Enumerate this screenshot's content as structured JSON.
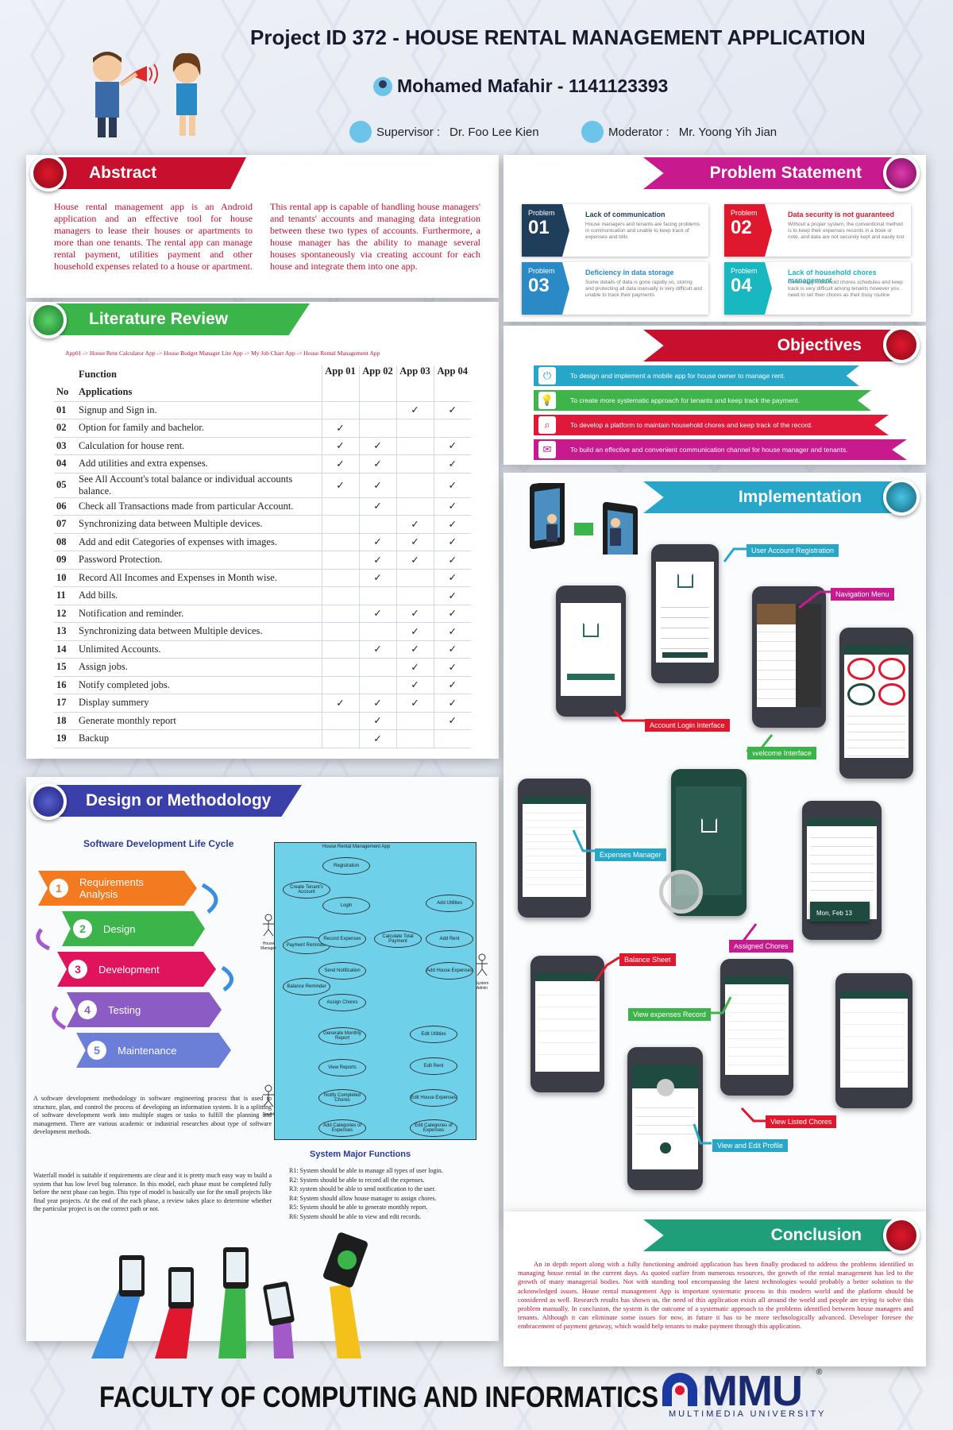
{
  "header": {
    "title": "Project ID 372 - HOUSE RENTAL MANAGEMENT APPLICATION",
    "student": "Mohamed Mafahir  -  1141123393",
    "supervisor_label": "Supervisor :",
    "supervisor": "Dr. Foo Lee Kien",
    "moderator_label": "Moderator :",
    "moderator": "Mr. Yoong Yih Jian"
  },
  "abstract": {
    "title": "Abstract",
    "p1": "House rental management app is an Android application and an effective tool for house managers to lease their houses or apartments to more than one tenants. The rental app can manage rental payment, utilities payment and other household expenses related to a house or apartment.",
    "p2": "This rental app is capable of handling house managers' and tenants' accounts and managing data integration between these two types of accounts. Furthermore, a house manager has the ability to manage several houses spontaneously via creating account for each house and integrate them into one app."
  },
  "literature": {
    "title": "Literature Review",
    "apps_note": "App01 -> House Rent Calculator App  ->  House Budget Manager Lite App  ->  My Job Chart App  ->  House Rental Management App",
    "head_function": "Function",
    "head_no": "No",
    "head_apps": "Applications",
    "app_cols": [
      "App 01",
      "App 02",
      "App 03",
      "App 04"
    ],
    "check": "✓",
    "rows": [
      {
        "no": "01",
        "f": "Signup and Sign in.",
        "m": [
          0,
          0,
          1,
          1
        ]
      },
      {
        "no": "02",
        "f": "Option for family and bachelor.",
        "m": [
          1,
          0,
          0,
          0
        ]
      },
      {
        "no": "03",
        "f": "Calculation for house rent.",
        "m": [
          1,
          1,
          0,
          1
        ]
      },
      {
        "no": "04",
        "f": "Add utilities and extra expenses.",
        "m": [
          1,
          1,
          0,
          1
        ]
      },
      {
        "no": "05",
        "f": "See All Account's total balance or individual accounts balance.",
        "m": [
          1,
          1,
          0,
          1
        ]
      },
      {
        "no": "06",
        "f": "Check all Transactions made from particular Account.",
        "m": [
          0,
          1,
          0,
          1
        ]
      },
      {
        "no": "07",
        "f": "Synchronizing data between Multiple devices.",
        "m": [
          0,
          0,
          1,
          1
        ]
      },
      {
        "no": "08",
        "f": "Add and edit Categories of expenses with images.",
        "m": [
          0,
          1,
          1,
          1
        ]
      },
      {
        "no": "09",
        "f": "Password Protection.",
        "m": [
          0,
          1,
          1,
          1
        ]
      },
      {
        "no": "10",
        "f": "Record All Incomes and Expenses in Month wise.",
        "m": [
          0,
          1,
          0,
          1
        ]
      },
      {
        "no": "11",
        "f": "Add bills.",
        "m": [
          0,
          0,
          0,
          1
        ]
      },
      {
        "no": "12",
        "f": "Notification and reminder.",
        "m": [
          0,
          1,
          1,
          1
        ]
      },
      {
        "no": "13",
        "f": "Synchronizing data between Multiple devices.",
        "m": [
          0,
          0,
          1,
          1
        ]
      },
      {
        "no": "14",
        "f": "Unlimited Accounts.",
        "m": [
          0,
          1,
          1,
          1
        ]
      },
      {
        "no": "15",
        "f": "Assign jobs.",
        "m": [
          0,
          0,
          1,
          1
        ]
      },
      {
        "no": "16",
        "f": "Notify completed jobs.",
        "m": [
          0,
          0,
          1,
          1
        ]
      },
      {
        "no": "17",
        "f": "Display summery",
        "m": [
          1,
          1,
          1,
          1
        ]
      },
      {
        "no": "18",
        "f": "Generate monthly report",
        "m": [
          0,
          1,
          0,
          1
        ]
      },
      {
        "no": "19",
        "f": "Backup",
        "m": [
          0,
          1,
          0,
          0
        ]
      }
    ]
  },
  "problem": {
    "title": "Problem Statement",
    "label": "Problem",
    "items": [
      {
        "num": "01",
        "title": "Lack of communication",
        "text": "House managers and tenants are facing problems in communication and unable to keep track of expenses and bills",
        "color": "#1f3e5c",
        "title_color": "#1f3e5c"
      },
      {
        "num": "02",
        "title": "Data security is not guaranteed",
        "text": "Without a proper system, the conventional method is to keep their expenses records in a book or note, and data are not securely kept and easily lost",
        "color": "#e0182d",
        "title_color": "#e0182d"
      },
      {
        "num": "03",
        "title": "Deficiency in data storage",
        "text": "Some details of data is gone rapidly so, storing and protecting all data manually is very difficult and unable to track their payments",
        "color": "#2a8ac6",
        "title_color": "#2a8ac6"
      },
      {
        "num": "04",
        "title": "Lack of household chores management",
        "text": "Generating household chores schedules and keep track is very difficult among tenants however you need to set their chores as their busy routine",
        "color": "#19b7c0",
        "title_color": "#19b7c0"
      }
    ]
  },
  "objectives": {
    "title": "Objectives",
    "items": [
      {
        "text": "To design and implement a mobile app for house owner to manage rent.",
        "color": "#27a6c8",
        "icon": "power-icon",
        "glyph": "⏻"
      },
      {
        "text": "To create more systematic approach for tenants and keep track the payment.",
        "color": "#3fb44a",
        "icon": "lightbulb-icon",
        "glyph": "💡"
      },
      {
        "text": "To develop a platform to maintain household chores and keep track of the record.",
        "color": "#e0183a",
        "icon": "search-icon",
        "glyph": "⌕"
      },
      {
        "text": "To build an effective and convenient communication channel for house manager and tenants.",
        "color": "#c81a8e",
        "icon": "mail-icon",
        "glyph": "✉"
      }
    ]
  },
  "implementation": {
    "title": "Implementation",
    "callouts": {
      "reg": "User Account Registration",
      "nav": "Navigation Menu",
      "login": "Account Login Interface",
      "welcome": "Welcome Interface",
      "expenses": "Expenses Manager",
      "chores": "Assigned Chores",
      "balance": "Balance Sheet",
      "viewexp": "View expenses Record",
      "listed": "View Listed Chores",
      "profile": "View and Edit Profile"
    },
    "date_chip": "Mon, Feb 13"
  },
  "design": {
    "title": "Design or Methodology",
    "sdlc_title": "Software Development Life Cycle",
    "steps": [
      {
        "n": "1",
        "label": "Requirements Analysis",
        "color": "#f47a20"
      },
      {
        "n": "2",
        "label": "Design",
        "color": "#3bb44a"
      },
      {
        "n": "3",
        "label": "Development",
        "color": "#e0145d"
      },
      {
        "n": "4",
        "label": "Testing",
        "color": "#8a5cc4"
      },
      {
        "n": "5",
        "label": "Maintenance",
        "color": "#6c7fd8"
      }
    ],
    "p1": "A software development methodology in software engineering process that is used to structure, plan, and control the process of developing an information system. It is a splitting of software development work into multiple stages or tasks to fulfill the planning and management. There are various academic or industrial researches about type of software development methods.",
    "p2": "Waterfall model is suitable if requirements are clear and it is pretty much easy way to build a system that has low level bug tolerance. In this model, each phase must be completed fully before the next phase can begin. This type of model is basically use for the small projects like final year projects. At the end of the each phase, a review takes place to determine whether the particular project is on the correct path or not.",
    "usecase_title": "House Rental Management App",
    "actor_left": "House Manager",
    "actor_right": "System Admin",
    "actor_bottom": "Tenant",
    "usecases": [
      "Registration",
      "Create Tenant's Account",
      "Login",
      "Payment Reminder",
      "Record Expenses",
      "Calculate Total Payment",
      "Add Utilities",
      "Add Rent",
      "Send Notification",
      "Add House Expenses",
      "Balance Reminder",
      "Assign Chores",
      "Generate Monthly Report",
      "Edit Utilities",
      "View Reports",
      "Edit Rent",
      "Notify Completed Chores",
      "Edit House Expenses",
      "Add Categories of Expenses",
      "Edit Categories of Expenses"
    ],
    "major_title": "System Major Functions",
    "functions": [
      "R1: System should be able to manage all types of user login.",
      "R2: System should be able to record all the expenses.",
      "R3: system should be able to send notification to the user.",
      "R4: System should allow house manager to assign chores.",
      "R5: System should be able to generate monthly report.",
      "R6: System should be able to view and edit records."
    ]
  },
  "conclusion": {
    "title": "Conclusion",
    "text": "An in depth report along with a fully functioning android application has been finally produced to address the problems identified in managing house rental in the current days. As quoted earlier from numerous resources, the growth of the rental management has led to the growth of many managerial bodies. Not with standing tool encompassing the latest technologies would probably a better solution to the acknowledged issues. House rental management App is important systematic process in this modern world and the platform should be considered as well. Research results has shown us, the need of this application exists all around the world and people are trying to solve this problem manually. In conclusion, the system is the outcome of a systematic approach to the problems identified between house managers and tenants. Although it can eliminate some issues for now, in future it has to be more technologically advanced. Developer foresee the embracement of payment getaway, which would help tenants to make payment through this application."
  },
  "footer": {
    "faculty": "FACULTY OF COMPUTING AND INFORMATICS",
    "logo": "MMU",
    "logo_sub": "MULTIMEDIA UNIVERSITY",
    "reg": "®"
  }
}
